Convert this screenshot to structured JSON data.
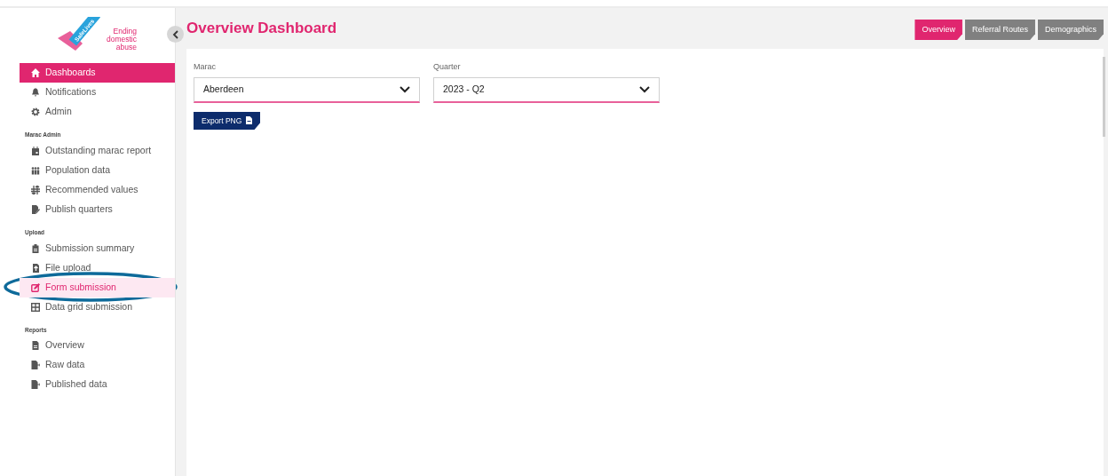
{
  "logo": {
    "brand": "SafeLives",
    "tagline": [
      "Ending",
      "domestic",
      "abuse"
    ]
  },
  "sidebar": {
    "sections": [
      {
        "items": [
          {
            "label": "Dashboards",
            "selected": true,
            "highlighted": false
          },
          {
            "label": "Notifications",
            "selected": false,
            "highlighted": false
          },
          {
            "label": "Admin",
            "selected": false,
            "highlighted": false
          }
        ]
      },
      {
        "heading": "Marac Admin",
        "items": [
          {
            "label": "Outstanding marac report",
            "selected": false,
            "highlighted": false
          },
          {
            "label": "Population data",
            "selected": false,
            "highlighted": false
          },
          {
            "label": "Recommended values",
            "selected": false,
            "highlighted": false
          },
          {
            "label": "Publish quarters",
            "selected": false,
            "highlighted": false
          }
        ]
      },
      {
        "heading": "Upload",
        "items": [
          {
            "label": "Submission summary",
            "selected": false,
            "highlighted": false
          },
          {
            "label": "File upload",
            "selected": false,
            "highlighted": false
          },
          {
            "label": "Form submission",
            "selected": false,
            "highlighted": true
          },
          {
            "label": "Data grid submission",
            "selected": false,
            "highlighted": false
          }
        ]
      },
      {
        "heading": "Reports",
        "items": [
          {
            "label": "Overview",
            "selected": false,
            "highlighted": false
          },
          {
            "label": "Raw data",
            "selected": false,
            "highlighted": false
          },
          {
            "label": "Published data",
            "selected": false,
            "highlighted": false
          }
        ]
      }
    ]
  },
  "page_title": "Overview Dashboard",
  "tabs": [
    {
      "label": "Overview",
      "selected": true
    },
    {
      "label": "Referral Routes",
      "selected": false
    },
    {
      "label": "Demographics",
      "selected": false
    }
  ],
  "filters": [
    {
      "label": "Marac",
      "value": "Aberdeen"
    },
    {
      "label": "Quarter",
      "value": "2023 - Q2"
    }
  ],
  "export_button": "Export PNG"
}
